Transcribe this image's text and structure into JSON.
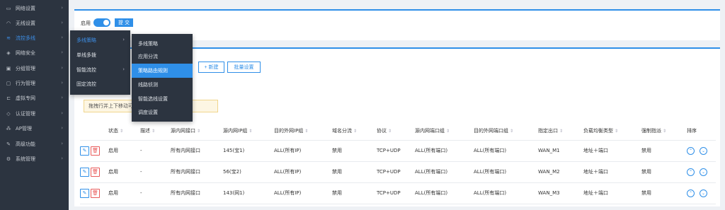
{
  "sidebar": {
    "items": [
      {
        "label": "网络设置",
        "icon": "monitor-icon",
        "glyph": "▭"
      },
      {
        "label": "无线设置",
        "icon": "wifi-icon",
        "glyph": "◠"
      },
      {
        "label": "流控多线",
        "icon": "flow-icon",
        "glyph": "≋"
      },
      {
        "label": "网络安全",
        "icon": "shield-icon",
        "glyph": "◈"
      },
      {
        "label": "分组管理",
        "icon": "group-icon",
        "glyph": "▣"
      },
      {
        "label": "行为管理",
        "icon": "behavior-icon",
        "glyph": "▢"
      },
      {
        "label": "虚拟专网",
        "icon": "vpn-icon",
        "glyph": "⊏"
      },
      {
        "label": "认证管理",
        "icon": "auth-icon",
        "glyph": "◇"
      },
      {
        "label": "AP管理",
        "icon": "ap-icon",
        "glyph": "⁂"
      },
      {
        "label": "高级功能",
        "icon": "advanced-icon",
        "glyph": "✎"
      },
      {
        "label": "系统管理",
        "icon": "system-icon",
        "glyph": "⚙"
      }
    ],
    "arrow": "›"
  },
  "top_card": {
    "toggle_label": "启用",
    "submit_label": "提 交"
  },
  "toolbar": {
    "new_label": "+ 新建",
    "batch_label": "批量设置"
  },
  "notice": "拖拽行并上下移动可以调整优先级(记得提交)",
  "table": {
    "headers": [
      "状态",
      "描述",
      "源内网接口",
      "源内网IP组",
      "目的外网IP组",
      "域名分流",
      "协议",
      "源内网端口组",
      "目的外网端口组",
      "指定出口",
      "负载均衡类型",
      "强制指派",
      "排序"
    ],
    "rows": [
      [
        "启用",
        "-",
        "所有内网接口",
        "145(宝1)",
        "ALL(所有IP)",
        "禁用",
        "TCP+UDP",
        "ALL(所有端口)",
        "ALL(所有端口)",
        "WAN_M1",
        "地址＋端口",
        "禁用"
      ],
      [
        "启用",
        "-",
        "所有内网接口",
        "56(宝2)",
        "ALL(所有IP)",
        "禁用",
        "TCP+UDP",
        "ALL(所有端口)",
        "ALL(所有端口)",
        "WAN_M2",
        "地址＋端口",
        "禁用"
      ],
      [
        "启用",
        "-",
        "所有内网接口",
        "143(网1)",
        "ALL(所有IP)",
        "禁用",
        "TCP+UDP",
        "ALL(所有端口)",
        "ALL(所有端口)",
        "WAN_M3",
        "地址＋端口",
        "禁用"
      ]
    ]
  },
  "menu1": {
    "items": [
      "多线策略",
      "单线多拨",
      "智能流控",
      "固定流控"
    ]
  },
  "menu2": {
    "items": [
      "多线策略",
      "应用分流",
      "策略路由规则",
      "线路侦测",
      "智能选线设置",
      "调度设置"
    ]
  },
  "colors": {
    "accent": "#2f8fe8",
    "sidebar_bg": "#2c3440",
    "danger": "#e85a5a"
  }
}
